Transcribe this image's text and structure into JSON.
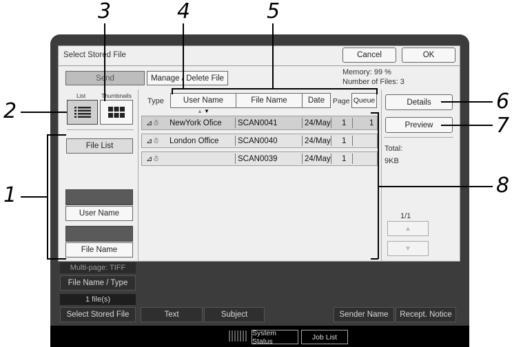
{
  "callouts": [
    "3",
    "4",
    "5",
    "2",
    "6",
    "7",
    "1",
    "8"
  ],
  "dialog": {
    "title": "Select Stored File",
    "cancel_label": "Cancel",
    "ok_label": "OK",
    "memory": "Memory: 99 %",
    "number_of_files": "Number of Files: 3"
  },
  "tabs": {
    "send": "Send",
    "manage": "Manage / Delete File"
  },
  "view": {
    "list_label": "List",
    "thumbnails_label": "Thumbnails"
  },
  "left": {
    "file_list": "File List",
    "user_name": "User Name",
    "file_name": "File Name"
  },
  "table": {
    "type_label": "Type",
    "page_label": "Page",
    "headers": {
      "user": "User Name",
      "file": "File Name",
      "date": "Date",
      "queue": "Queue"
    },
    "rows": [
      {
        "user": "NewYork Ofice",
        "file": "SCAN0041",
        "date": "24/May",
        "page": "1",
        "queue": "1"
      },
      {
        "user": "London Office",
        "file": "SCAN0040",
        "date": "24/May",
        "page": "1",
        "queue": ""
      },
      {
        "user": "",
        "file": "SCAN0039",
        "date": "24/May",
        "page": "1",
        "queue": ""
      }
    ]
  },
  "right": {
    "details": "Details",
    "preview": "Preview",
    "total_label": "Total:",
    "total_value": "9KB",
    "pager": "1/1"
  },
  "lower": {
    "multipage": "Multi-page: TIFF",
    "file_name_type": "File Name / Type",
    "files_count": "1 file(s)",
    "select_stored_file": "Select Stored File",
    "text_btn": "Text",
    "subject_btn": "Subject",
    "sender_name_btn": "Sender Name",
    "recept_notice_btn": "Recept. Notice"
  },
  "status_bar": {
    "system_status": "System Status",
    "job_list": "Job List"
  },
  "colors": {
    "panel": "#efefef",
    "device": "#3c3c3c"
  }
}
